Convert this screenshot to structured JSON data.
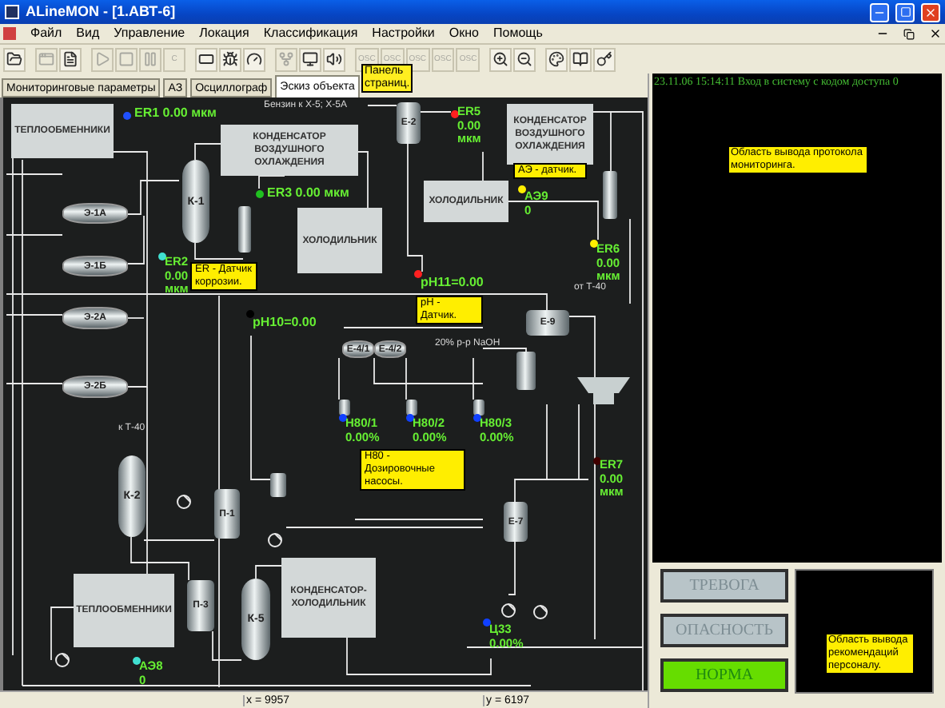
{
  "window": {
    "title": "ALineMON - [1.АВТ-6]"
  },
  "menu": [
    "Файл",
    "Вид",
    "Управление",
    "Локация",
    "Классификация",
    "Настройки",
    "Окно",
    "Помощь"
  ],
  "toolbar": [
    {
      "disabled": false
    },
    {
      "disabled": true
    },
    {
      "disabled": false
    },
    {
      "disabled": true
    },
    {
      "disabled": true
    },
    {
      "disabled": true
    },
    {
      "disabled": true,
      "label": "C"
    },
    {
      "disabled": false
    },
    {
      "disabled": false
    },
    {
      "disabled": false
    },
    {
      "disabled": true
    },
    {
      "disabled": false
    },
    {
      "disabled": false
    },
    {
      "disabled": true,
      "label": "OSC"
    },
    {
      "disabled": true,
      "label": "OSC"
    },
    {
      "disabled": true,
      "label": "OSC"
    },
    {
      "disabled": true,
      "label": "OSC"
    },
    {
      "disabled": true,
      "label": "OSC"
    },
    {
      "disabled": false
    },
    {
      "disabled": false
    },
    {
      "disabled": false
    },
    {
      "disabled": false
    },
    {
      "disabled": false
    }
  ],
  "toolbar_tooltip": "Панель страниц.",
  "tabs": [
    {
      "label": "Мониторинговые параметры",
      "selected": false
    },
    {
      "label": "АЗ",
      "selected": false
    },
    {
      "label": "Осциллограф",
      "selected": false
    },
    {
      "label": "Эскиз объекта",
      "selected": true
    }
  ],
  "diagram": {
    "stream_labels": [
      "Бензин к Х-5; Х-5А",
      "от Т-40",
      "20% р-р NaOH",
      "к Т-40"
    ],
    "blocks": [
      "ТЕПЛООБМЕННИКИ",
      "КОНДЕНСАТОР ВОЗДУШНОГО ОХЛАЖДЕНИЯ",
      "ХОЛОДИЛЬНИК",
      "КОНДЕНСАТОР ВОЗДУШНОГО ОХЛАЖДЕНИЯ",
      "ХОЛОДИЛЬНИК",
      "ТЕПЛООБМЕННИКИ",
      "КОНДЕНСАТОР-ХОЛОДИЛЬНИК"
    ],
    "equipment": [
      {
        "label": "К-1",
        "kind": "column"
      },
      {
        "label": "Э-1А",
        "kind": "exchanger"
      },
      {
        "label": "Э-1Б",
        "kind": "exchanger"
      },
      {
        "label": "Э-2А",
        "kind": "exchanger"
      },
      {
        "label": "Э-2Б",
        "kind": "exchanger"
      },
      {
        "label": "Е-2",
        "kind": "drum"
      },
      {
        "label": "Е-9",
        "kind": "drum"
      },
      {
        "label": "Е-4/1",
        "kind": "exchanger"
      },
      {
        "label": "Е-4/2",
        "kind": "exchanger"
      },
      {
        "label": "К-2",
        "kind": "column"
      },
      {
        "label": "П-1",
        "kind": "drum"
      },
      {
        "label": "П-3",
        "kind": "drum"
      },
      {
        "label": "К-5",
        "kind": "column"
      },
      {
        "label": "Е-7",
        "kind": "drum"
      }
    ],
    "sensors": [
      {
        "kind": "inline",
        "lines": [
          "ER1 0.00 мкм"
        ],
        "color": "#2050ff"
      },
      {
        "kind": "stacked",
        "lines": [
          "ER5",
          "0.00",
          "мкм"
        ],
        "color": "#ff2020"
      },
      {
        "kind": "inline",
        "lines": [
          "ER3 0.00 мкм"
        ],
        "color": "#20c020"
      },
      {
        "kind": "stacked",
        "lines": [
          "АЭ9",
          "0"
        ],
        "color": "#ffee00"
      },
      {
        "kind": "stacked",
        "lines": [
          "ER2",
          "0.00",
          "мкм"
        ],
        "color": "#40e0d0"
      },
      {
        "kind": "stacked",
        "lines": [
          "ER6",
          "0.00",
          "мкм"
        ],
        "color": "#ffee00"
      },
      {
        "kind": "inline",
        "lines": [
          "pH11=0.00"
        ],
        "color": "#ff2020"
      },
      {
        "kind": "inline",
        "lines": [
          "pH10=0.00"
        ],
        "color": "#000000"
      },
      {
        "kind": "stacked",
        "lines": [
          "Н80/1",
          "0.00%"
        ],
        "color": "#1040ff"
      },
      {
        "kind": "stacked",
        "lines": [
          "Н80/2",
          "0.00%"
        ],
        "color": "#1040ff"
      },
      {
        "kind": "stacked",
        "lines": [
          "Н80/3",
          "0.00%"
        ],
        "color": "#1040ff"
      },
      {
        "kind": "stacked",
        "lines": [
          "ER7",
          "0.00",
          "мкм"
        ],
        "color": "#400000"
      },
      {
        "kind": "stacked",
        "lines": [
          "Ц33",
          "0.00%"
        ],
        "color": "#1040ff"
      },
      {
        "kind": "stacked",
        "lines": [
          "АЭ8",
          "0"
        ],
        "color": "#40e0d0"
      }
    ],
    "callouts": [
      "ER - Датчик коррозии.",
      "АЭ - датчик.",
      "pH - Датчик.",
      "Н80 - Дозировочные насосы."
    ]
  },
  "status_bar": [
    "x = 9957",
    "y = 6197"
  ],
  "log": {
    "entries": [
      "23.11.06 15:14:11 Вход в систему с кодом доступа 0"
    ],
    "hint": "Область вывода протокола мониторинга."
  },
  "alarm_buttons": [
    {
      "label": "ТРЕВОГА",
      "selected": false
    },
    {
      "label": "ОПАСНОСТЬ",
      "selected": false
    },
    {
      "label": "НОРМА",
      "selected": true
    }
  ],
  "recommendations": {
    "hint": "Область вывода рекомендаций персоналу."
  }
}
